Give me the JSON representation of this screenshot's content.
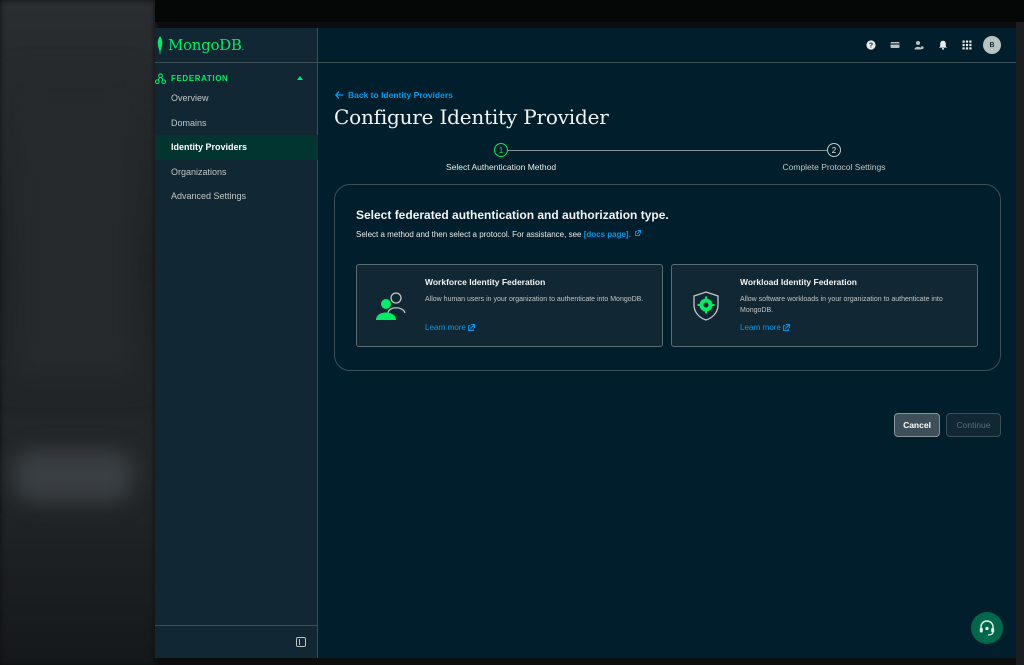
{
  "app": {
    "logo_text": "MongoDB",
    "logo_mark": "."
  },
  "sidebar": {
    "section_label": "FEDERATION",
    "items": [
      {
        "label": "Overview"
      },
      {
        "label": "Domains"
      },
      {
        "label": "Identity Providers",
        "active": true
      },
      {
        "label": "Organizations"
      },
      {
        "label": "Advanced Settings"
      }
    ]
  },
  "topbar": {
    "icons": [
      "help-icon",
      "billing-icon",
      "user-access-icon",
      "notifications-bell-icon",
      "apps-grid-icon"
    ],
    "avatar_initial": "B"
  },
  "main": {
    "back_link": "Back to Identity Providers",
    "title": "Configure Identity Provider",
    "steps": [
      {
        "number": "1",
        "label": "Select Authentication Method",
        "active": true
      },
      {
        "number": "2",
        "label": "Complete Protocol Settings",
        "active": false
      }
    ],
    "panel": {
      "title": "Select federated authentication and authorization type.",
      "subtitle": "Select a method and then select a protocol. For assistance, see",
      "docs_link": "[docs page].",
      "cards": [
        {
          "title": "Workforce Identity Federation",
          "description": "Allow human users in your organization to authenticate into MongoDB.",
          "link": "Learn more"
        },
        {
          "title": "Workload Identity Federation",
          "description": "Allow software workloads in your organization to authenticate into MongoDB.",
          "link": "Learn more"
        }
      ]
    },
    "buttons": {
      "cancel": "Cancel",
      "continue": "Continue"
    }
  },
  "colors": {
    "brand_green": "#00ed64",
    "link_blue": "#0498ec",
    "background": "#001e2b",
    "sidebar_bg": "#112733"
  }
}
